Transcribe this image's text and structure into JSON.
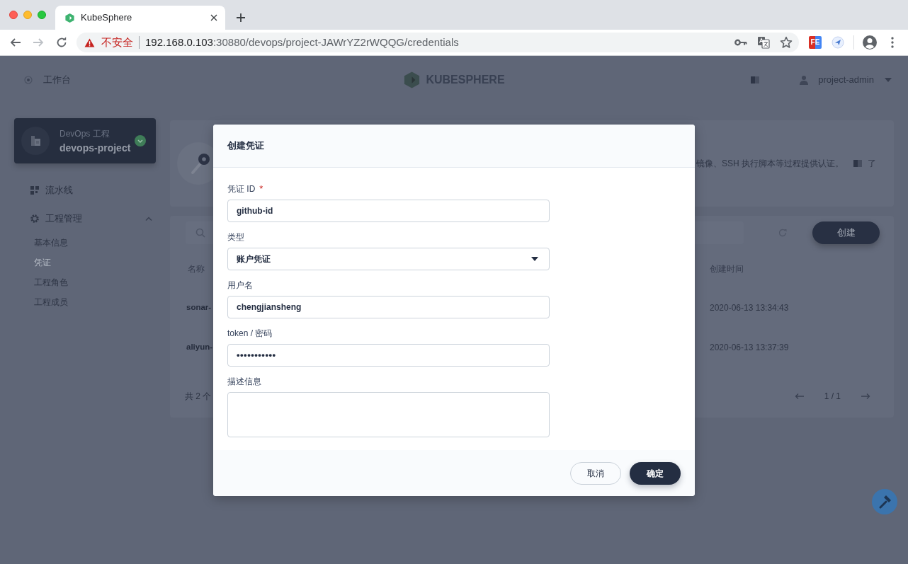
{
  "browser": {
    "tab": {
      "title": "KubeSphere"
    },
    "security_label": "不安全",
    "url": {
      "host": "192.168.0.103",
      "path": ":30880/devops/project-JAWrYZ2rWQQG/credentials"
    },
    "extension_label": "FE"
  },
  "header": {
    "workbench": "工作台",
    "logo": "KUBESPHERE",
    "user": "project-admin"
  },
  "sidebar": {
    "project": {
      "type": "DevOps 工程",
      "name": "devops-project"
    },
    "items": [
      {
        "label": "流水线",
        "kind": "link"
      },
      {
        "label": "工程管理",
        "kind": "group",
        "expanded": true,
        "children": [
          {
            "label": "基本信息",
            "selected": false
          },
          {
            "label": "凭证",
            "selected": true
          },
          {
            "label": "工程角色",
            "selected": false
          },
          {
            "label": "工程成员",
            "selected": false
          }
        ]
      }
    ]
  },
  "banner": {
    "description": "镜像、SSH 执行脚本等过程提供认证。",
    "link": "了"
  },
  "toolbar": {
    "create_button": "创建"
  },
  "table": {
    "columns": [
      "名称",
      "创建时间"
    ],
    "rows": [
      {
        "name": "sonar-",
        "created": "2020-06-13 13:34:43"
      },
      {
        "name": "aliyun-",
        "created": "2020-06-13 13:37:39"
      }
    ],
    "total": "共 2 个",
    "page": "1 / 1"
  },
  "dialog": {
    "title": "创建凭证",
    "fields": [
      {
        "kind": "text",
        "label": "凭证 ID",
        "required_mark": "*",
        "value": "github-id"
      },
      {
        "kind": "select",
        "label": "类型",
        "value": "账户凭证"
      },
      {
        "kind": "text",
        "label": "用户名",
        "value": "chengjiansheng"
      },
      {
        "kind": "password",
        "label": "token / 密码",
        "value": "•••••••••••"
      },
      {
        "kind": "textarea",
        "label": "描述信息"
      }
    ],
    "buttons": [
      {
        "label": "取消",
        "kind": "secondary"
      },
      {
        "label": "确定",
        "kind": "primary"
      }
    ]
  }
}
